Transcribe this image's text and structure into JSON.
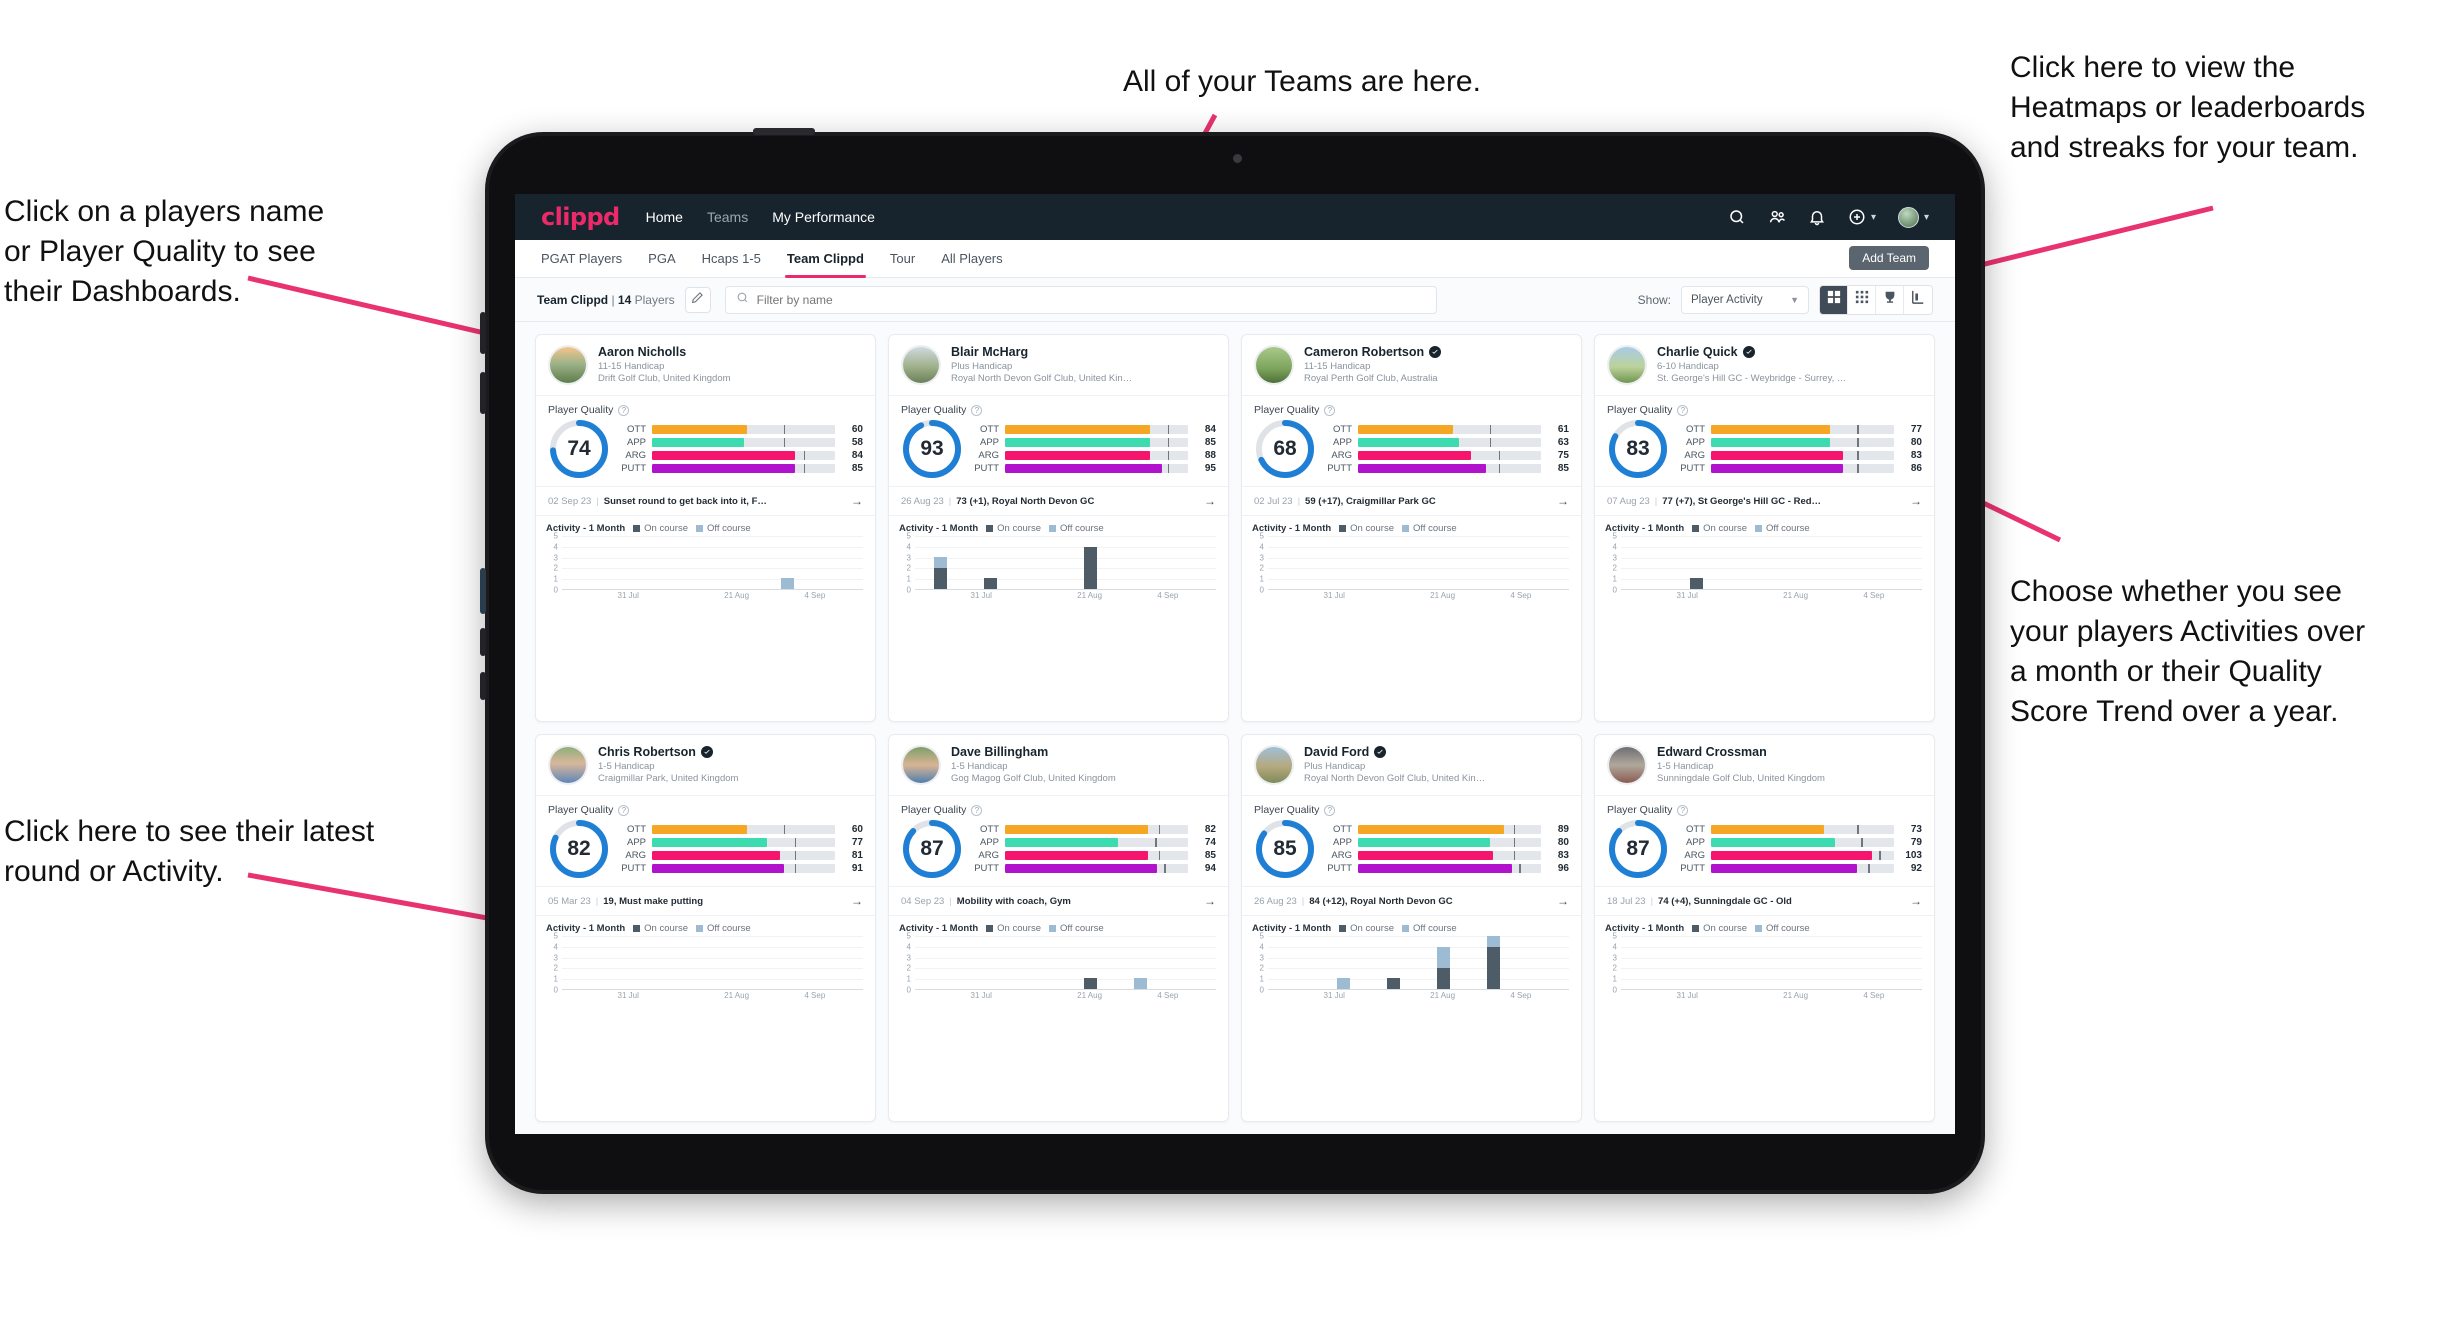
{
  "annotations": [
    {
      "id": "teams",
      "text": "All of your Teams are here."
    },
    {
      "id": "heatmaps",
      "text": "Click here to view the\nHeatmaps or leaderboards\nand streaks for your team."
    },
    {
      "id": "players-name",
      "text": "Click on a players name\nor Player Quality to see\ntheir Dashboards."
    },
    {
      "id": "activity-choice",
      "text": "Choose whether you see\nyour players Activities over\na month or their Quality\nScore Trend over a year."
    },
    {
      "id": "latest-round",
      "text": "Click here to see their latest\nround or Activity."
    }
  ],
  "app": {
    "brand": "clippd",
    "nav": [
      {
        "label": "Home",
        "active": true
      },
      {
        "label": "Teams",
        "active": false
      },
      {
        "label": "My Performance",
        "active": true
      }
    ],
    "topRightIcons": [
      "search-icon",
      "people-icon",
      "bell-icon",
      "plus-circle-icon",
      "avatar"
    ],
    "subtabs": [
      {
        "label": "PGAT Players",
        "active": false
      },
      {
        "label": "PGA",
        "active": false
      },
      {
        "label": "Hcaps 1-5",
        "active": false
      },
      {
        "label": "Team Clippd",
        "active": true
      },
      {
        "label": "Tour",
        "active": false
      },
      {
        "label": "All Players",
        "active": false
      }
    ],
    "add_team_label": "Add Team",
    "filter": {
      "team_name": "Team Clippd",
      "team_divider": " | ",
      "player_count": "14",
      "players_word": " Players",
      "edit_icon": "pencil-icon",
      "search_placeholder": "Filter by name",
      "search_value": "",
      "show_label": "Show:",
      "show_value": "Player Activity",
      "show_options": [
        "Player Activity",
        "Quality Score Trend"
      ],
      "view_buttons": [
        {
          "name": "grid-large-view",
          "icon": "grid-large-icon",
          "active": true
        },
        {
          "name": "grid-small-view",
          "icon": "grid-small-icon",
          "active": false
        },
        {
          "name": "leaderboard-view",
          "icon": "trophy-icon",
          "active": false
        },
        {
          "name": "heatmap-view",
          "icon": "heatmap-icon",
          "active": false
        }
      ]
    }
  },
  "labels": {
    "player_quality": "Player Quality",
    "activity_title": "Activity - 1 Month",
    "legend_on": "On course",
    "legend_off": "Off course",
    "metric_names": [
      "OTT",
      "APP",
      "ARG",
      "PUTT"
    ]
  },
  "colors": {
    "brand_pink": "#ec2a6a",
    "nav_dark": "#17242e",
    "ott": "#f5a623",
    "app": "#3ddbb0",
    "arg": "#f5156c",
    "putt": "#b112cc",
    "donut": "#1f7fd4",
    "on_course": "#4e5c68",
    "off_course": "#9dbcd4"
  },
  "chart_data": {
    "type": "bar",
    "title": "Activity - 1 Month",
    "ylim": [
      0,
      5
    ],
    "yticks": [
      0,
      1,
      2,
      3,
      4,
      5
    ],
    "xticks": [
      "31 Jul",
      "21 Aug",
      "4 Sep"
    ],
    "legend": [
      "On course",
      "Off course"
    ],
    "charts": [
      {
        "player": "Aaron Nicholls",
        "bars": [
          [
            0,
            0
          ],
          [
            0,
            0
          ],
          [
            0,
            0
          ],
          [
            0,
            0
          ],
          [
            0,
            1
          ],
          [
            0,
            0
          ]
        ]
      },
      {
        "player": "Blair McHarg",
        "bars": [
          [
            2,
            1
          ],
          [
            1,
            0
          ],
          [
            0,
            0
          ],
          [
            4,
            0
          ],
          [
            0,
            0
          ],
          [
            0,
            0
          ]
        ]
      },
      {
        "player": "Cameron Robertson",
        "bars": [
          [
            0,
            0
          ],
          [
            0,
            0
          ],
          [
            0,
            0
          ],
          [
            0,
            0
          ],
          [
            0,
            0
          ],
          [
            0,
            0
          ]
        ]
      },
      {
        "player": "Charlie Quick",
        "bars": [
          [
            0,
            0
          ],
          [
            1,
            0
          ],
          [
            0,
            0
          ],
          [
            0,
            0
          ],
          [
            0,
            0
          ],
          [
            0,
            0
          ]
        ]
      },
      {
        "player": "Chris Robertson",
        "bars": [
          [
            0,
            0
          ],
          [
            0,
            0
          ],
          [
            0,
            0
          ],
          [
            0,
            0
          ],
          [
            0,
            0
          ],
          [
            0,
            0
          ]
        ]
      },
      {
        "player": "Dave Billingham",
        "bars": [
          [
            0,
            0
          ],
          [
            0,
            0
          ],
          [
            0,
            0
          ],
          [
            1,
            0
          ],
          [
            0,
            1
          ],
          [
            0,
            0
          ]
        ]
      },
      {
        "player": "David Ford",
        "bars": [
          [
            0,
            0
          ],
          [
            0,
            1
          ],
          [
            1,
            0
          ],
          [
            2,
            2
          ],
          [
            4,
            1
          ],
          [
            0,
            0
          ]
        ]
      },
      {
        "player": "Edward Crossman",
        "bars": [
          [
            0,
            0
          ],
          [
            0,
            0
          ],
          [
            0,
            0
          ],
          [
            0,
            0
          ],
          [
            0,
            0
          ],
          [
            0,
            0
          ]
        ]
      }
    ]
  },
  "players": [
    {
      "name": "Aaron Nicholls",
      "verified": false,
      "handicap": "11-15 Handicap",
      "club": "Drift Golf Club, United Kingdom",
      "quality": 74,
      "metrics": [
        {
          "label": "OTT",
          "value": 60,
          "fill": 52,
          "tick": 72
        },
        {
          "label": "APP",
          "value": 58,
          "fill": 50,
          "tick": 72
        },
        {
          "label": "ARG",
          "value": 84,
          "fill": 78,
          "tick": 83
        },
        {
          "label": "PUTT",
          "value": 85,
          "fill": 78,
          "tick": 83
        }
      ],
      "latest_date": "02 Sep 23",
      "latest_text": "Sunset round to get back into it, F…",
      "avatar": "sunset-golf"
    },
    {
      "name": "Blair McHarg",
      "verified": false,
      "handicap": "Plus Handicap",
      "club": "Royal North Devon Golf Club, United Kin…",
      "quality": 93,
      "metrics": [
        {
          "label": "OTT",
          "value": 84,
          "fill": 79,
          "tick": 89
        },
        {
          "label": "APP",
          "value": 85,
          "fill": 79,
          "tick": 89
        },
        {
          "label": "ARG",
          "value": 88,
          "fill": 79,
          "tick": 89
        },
        {
          "label": "PUTT",
          "value": 95,
          "fill": 86,
          "tick": 89
        }
      ],
      "latest_date": "26 Aug 23",
      "latest_text": "73 (+1), Royal North Devon GC",
      "avatar": "links-golfer"
    },
    {
      "name": "Cameron Robertson",
      "verified": true,
      "handicap": "11-15 Handicap",
      "club": "Royal Perth Golf Club, Australia",
      "quality": 68,
      "metrics": [
        {
          "label": "OTT",
          "value": 61,
          "fill": 52,
          "tick": 72
        },
        {
          "label": "APP",
          "value": 63,
          "fill": 55,
          "tick": 72
        },
        {
          "label": "ARG",
          "value": 75,
          "fill": 62,
          "tick": 77
        },
        {
          "label": "PUTT",
          "value": 85,
          "fill": 70,
          "tick": 77
        }
      ],
      "latest_date": "02 Jul 23",
      "latest_text": "59 (+17), Craigmillar Park GC",
      "avatar": "fairway-green"
    },
    {
      "name": "Charlie Quick",
      "verified": true,
      "handicap": "6-10 Handicap",
      "club": "St. George's Hill GC - Weybridge - Surrey, …",
      "quality": 83,
      "metrics": [
        {
          "label": "OTT",
          "value": 77,
          "fill": 65,
          "tick": 80
        },
        {
          "label": "APP",
          "value": 80,
          "fill": 65,
          "tick": 80
        },
        {
          "label": "ARG",
          "value": 83,
          "fill": 72,
          "tick": 80
        },
        {
          "label": "PUTT",
          "value": 86,
          "fill": 72,
          "tick": 80
        }
      ],
      "latest_date": "07 Aug 23",
      "latest_text": "77 (+7), St George's Hill GC - Red…",
      "avatar": "course-blue-sky"
    },
    {
      "name": "Chris Robertson",
      "verified": true,
      "handicap": "1-5 Handicap",
      "club": "Craigmillar Park, United Kingdom",
      "quality": 82,
      "metrics": [
        {
          "label": "OTT",
          "value": 60,
          "fill": 52,
          "tick": 72
        },
        {
          "label": "APP",
          "value": 77,
          "fill": 63,
          "tick": 78
        },
        {
          "label": "ARG",
          "value": 81,
          "fill": 70,
          "tick": 78
        },
        {
          "label": "PUTT",
          "value": 91,
          "fill": 72,
          "tick": 78
        }
      ],
      "latest_date": "05 Mar 23",
      "latest_text": "19, Must make putting",
      "avatar": "man-glasses"
    },
    {
      "name": "Dave Billingham",
      "verified": false,
      "handicap": "1-5 Handicap",
      "club": "Gog Magog Golf Club, United Kingdom",
      "quality": 87,
      "metrics": [
        {
          "label": "OTT",
          "value": 82,
          "fill": 78,
          "tick": 84
        },
        {
          "label": "APP",
          "value": 74,
          "fill": 62,
          "tick": 82
        },
        {
          "label": "ARG",
          "value": 85,
          "fill": 78,
          "tick": 84
        },
        {
          "label": "PUTT",
          "value": 94,
          "fill": 83,
          "tick": 87
        }
      ],
      "latest_date": "04 Sep 23",
      "latest_text": "Mobility with coach, Gym",
      "avatar": "man-beard"
    },
    {
      "name": "David Ford",
      "verified": true,
      "handicap": "Plus Handicap",
      "club": "Royal North Devon Golf Club, United Kin…",
      "quality": 85,
      "metrics": [
        {
          "label": "OTT",
          "value": 89,
          "fill": 80,
          "tick": 85
        },
        {
          "label": "APP",
          "value": 80,
          "fill": 72,
          "tick": 85
        },
        {
          "label": "ARG",
          "value": 83,
          "fill": 74,
          "tick": 85
        },
        {
          "label": "PUTT",
          "value": 96,
          "fill": 84,
          "tick": 88
        }
      ],
      "latest_date": "26 Aug 23",
      "latest_text": "84 (+12), Royal North Devon GC",
      "avatar": "coastal-golfer"
    },
    {
      "name": "Edward Crossman",
      "verified": false,
      "handicap": "1-5 Handicap",
      "club": "Sunningdale Golf Club, United Kingdom",
      "quality": 87,
      "metrics": [
        {
          "label": "OTT",
          "value": 73,
          "fill": 62,
          "tick": 80
        },
        {
          "label": "APP",
          "value": 79,
          "fill": 68,
          "tick": 82
        },
        {
          "label": "ARG",
          "value": 103,
          "fill": 88,
          "tick": 92
        },
        {
          "label": "PUTT",
          "value": 92,
          "fill": 80,
          "tick": 86
        }
      ],
      "latest_date": "18 Jul 23",
      "latest_text": "74 (+4), Sunningdale GC - Old",
      "avatar": "indoor-person"
    }
  ]
}
